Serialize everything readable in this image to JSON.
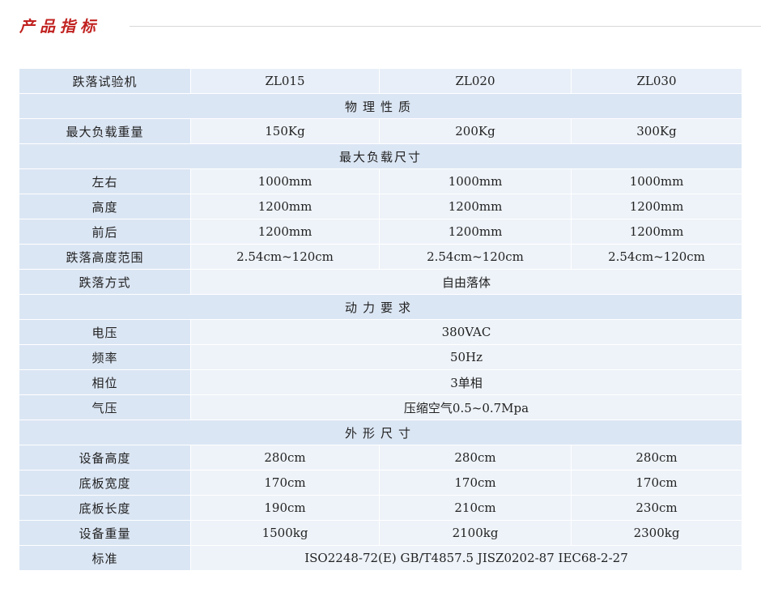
{
  "heading": "产品指标",
  "table": {
    "header": [
      "跌落试验机",
      "ZL015",
      "ZL020",
      "ZL030"
    ],
    "sections": {
      "physical": "物理性质",
      "load_size": "最大负载尺寸",
      "power": "动力要求",
      "outline": "外形尺寸"
    },
    "rows": {
      "max_load": {
        "label": "最大负载重量",
        "values": [
          "150Kg",
          "200Kg",
          "300Kg"
        ]
      },
      "left_right": {
        "label": "左右",
        "values": [
          "1000mm",
          "1000mm",
          "1000mm"
        ]
      },
      "height": {
        "label": "高度",
        "values": [
          "1200mm",
          "1200mm",
          "1200mm"
        ]
      },
      "front_back": {
        "label": "前后",
        "values": [
          "1200mm",
          "1200mm",
          "1200mm"
        ]
      },
      "drop_range": {
        "label": "跌落高度范围",
        "values": [
          "2.54cm~120cm",
          "2.54cm~120cm",
          "2.54cm~120cm"
        ]
      },
      "drop_mode": {
        "label": "跌落方式",
        "value": "自由落体"
      },
      "voltage": {
        "label": "电压",
        "value": "380VAC"
      },
      "frequency": {
        "label": "频率",
        "value": "50Hz"
      },
      "phase": {
        "label": "相位",
        "value": "3单相"
      },
      "air": {
        "label": "气压",
        "value": "压缩空气0.5~0.7Mpa"
      },
      "equip_height": {
        "label": "设备高度",
        "values": [
          "280cm",
          "280cm",
          "280cm"
        ]
      },
      "base_width": {
        "label": "底板宽度",
        "values": [
          "170cm",
          "170cm",
          "170cm"
        ]
      },
      "base_length": {
        "label": "底板长度",
        "values": [
          "190cm",
          "210cm",
          "230cm"
        ]
      },
      "equip_weight": {
        "label": "设备重量",
        "values": [
          "1500kg",
          "2100kg",
          "2300kg"
        ]
      },
      "standard": {
        "label": "标准",
        "value": "ISO2248-72(E) GB/T4857.5 JISZ0202-87 IEC68-2-27"
      }
    }
  }
}
